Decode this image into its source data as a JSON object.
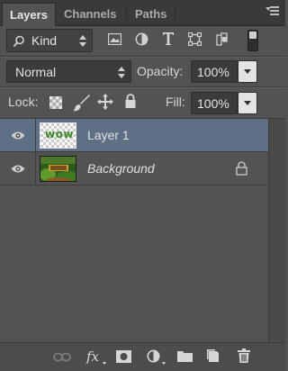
{
  "tabs": [
    {
      "label": "Layers",
      "active": true
    },
    {
      "label": "Channels",
      "active": false
    },
    {
      "label": "Paths",
      "active": false
    }
  ],
  "filter": {
    "kind_value": "Kind",
    "icons": [
      "search-icon",
      "pixel-layer-filter-icon",
      "adjustment-layer-filter-icon",
      "type-layer-filter-icon",
      "shape-layer-filter-icon",
      "smart-object-filter-icon",
      "filter-toggle-icon"
    ]
  },
  "blend": {
    "mode_value": "Normal",
    "opacity_label": "Opacity:",
    "opacity_value": "100%"
  },
  "lock": {
    "label": "Lock:",
    "icons": [
      "lock-transparent-pixels-icon",
      "lock-image-pixels-icon",
      "lock-position-icon",
      "lock-all-icon"
    ],
    "fill_label": "Fill:",
    "fill_value": "100%"
  },
  "layers": [
    {
      "name": "Layer 1",
      "visible": true,
      "selected": true,
      "italic": false,
      "thumb_text": "wow",
      "locked": false
    },
    {
      "name": "Background",
      "visible": true,
      "selected": false,
      "italic": true,
      "thumb_text": "",
      "locked": true
    }
  ],
  "bottom_icons": [
    "link-layers-icon",
    "fx-icon",
    "add-mask-icon",
    "adjustment-layer-icon",
    "new-group-icon",
    "new-layer-icon",
    "delete-layer-icon"
  ],
  "fx_label": "fx",
  "colors": {
    "panel": "#535353",
    "selected_row": "#5f6f84",
    "field": "#3b3b3b"
  }
}
